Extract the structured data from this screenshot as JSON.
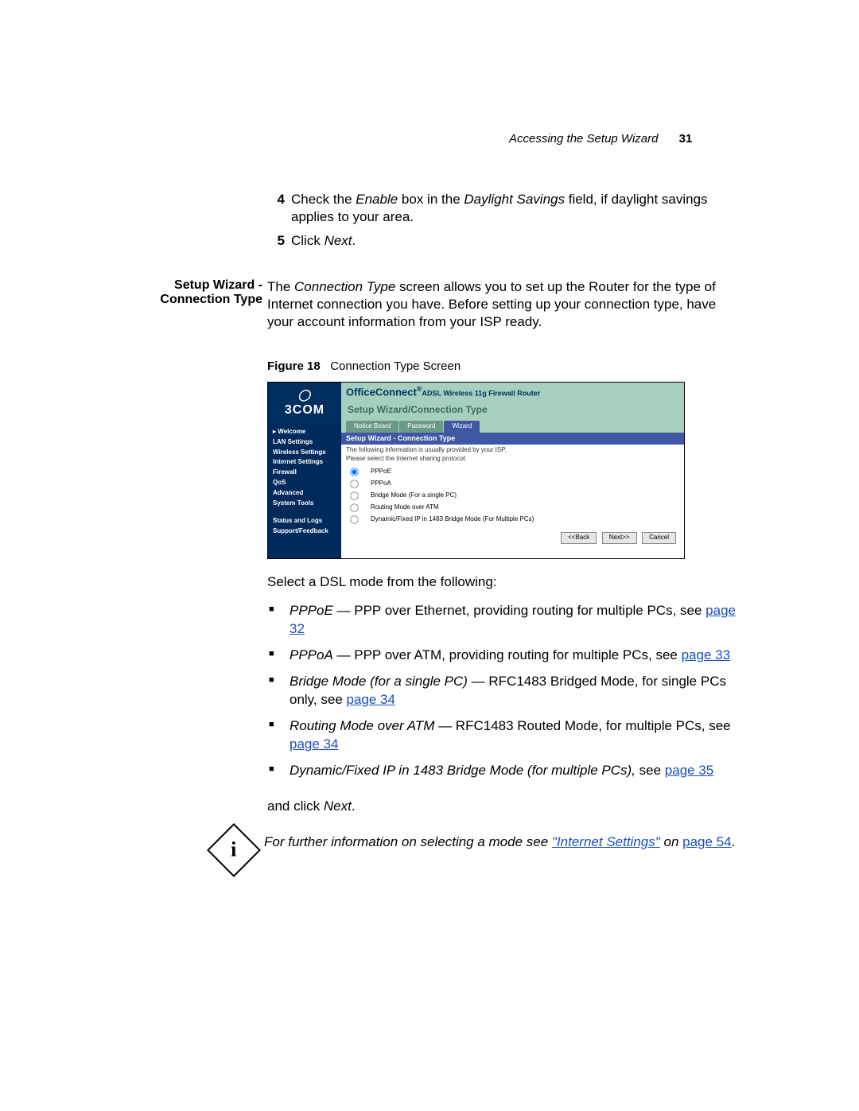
{
  "header": {
    "section": "Accessing the Setup Wizard",
    "page": "31"
  },
  "step4": {
    "num": "4",
    "prefix": "Check the ",
    "em1": "Enable",
    "mid1": " box in the ",
    "em2": "Daylight Savings",
    "mid2": " field, if daylight savings applies to your area."
  },
  "step5": {
    "num": "5",
    "prefix": "Click ",
    "em": "Next",
    "suffix": "."
  },
  "section_label_1": "Setup Wizard -",
  "section_label_2": "Connection Type",
  "section_intro": {
    "prefix": "The ",
    "em": "Connection Type",
    "rest": " screen allows you to set up the Router for the type of Internet connection you have. Before setting up your connection type, have your account information from your ISP ready."
  },
  "figure": {
    "num": "Figure 18",
    "title": "Connection Type Screen"
  },
  "fig": {
    "logo": "3COM",
    "brand_bold": "OfficeConnect",
    "brand_small": "ADSL Wireless 11g Firewall Router",
    "crumb": "Setup Wizard/Connection Type",
    "tabs": {
      "a": "Notice Board",
      "b": "Password",
      "c": "Wizard"
    },
    "nav": {
      "a": "Welcome",
      "b": "LAN Settings",
      "c": "Wireless Settings",
      "d": "Internet Settings",
      "e": "Firewall",
      "f": "QoS",
      "g": "Advanced",
      "h": "System Tools",
      "i": "Status and Logs",
      "j": "Support/Feedback"
    },
    "panel_title": "Setup Wizard - Connection Type",
    "panel_desc1": "The following information is usually provided by your ISP.",
    "panel_desc2": "Please select the Internet sharing protocol:",
    "opts": {
      "a": "PPPoE",
      "b": "PPPoA",
      "c": "Bridge Mode (For a single PC)",
      "d": "Routing Mode over ATM",
      "e": "Dynamic/Fixed IP in 1483 Bridge Mode (For Multiple PCs)"
    },
    "btn_back": "<<Back",
    "btn_next": "Next>>",
    "btn_cancel": "Cancel"
  },
  "select_text": "Select a DSL mode from the following:",
  "bullets": {
    "a_em": "PPPoE",
    "a_mid": " — PPP over Ethernet, providing routing for multiple PCs, see ",
    "a_link": "page 32",
    "b_em": "PPPoA",
    "b_mid": " — PPP over ATM, providing routing for multiple PCs, see ",
    "b_link": "page 33",
    "c_em": "Bridge Mode (for a single PC)",
    "c_mid": " — RFC1483 Bridged Mode, for single PCs only, see ",
    "c_link": "page 34",
    "d_em": "Routing Mode over ATM",
    "d_mid": " — RFC1483 Routed Mode, for multiple PCs, see ",
    "d_link": "page 34",
    "e_em": "Dynamic/Fixed IP in 1483 Bridge Mode (for multiple PCs),",
    "e_mid": " see ",
    "e_link": "page 35"
  },
  "after_list": {
    "prefix": "and click ",
    "em": "Next",
    "suffix": "."
  },
  "note": {
    "prefix": "For further information on selecting a mode see ",
    "link1": "\"Internet Settings\"",
    "mid": " on ",
    "link2": "page 54",
    "suffix": "."
  }
}
